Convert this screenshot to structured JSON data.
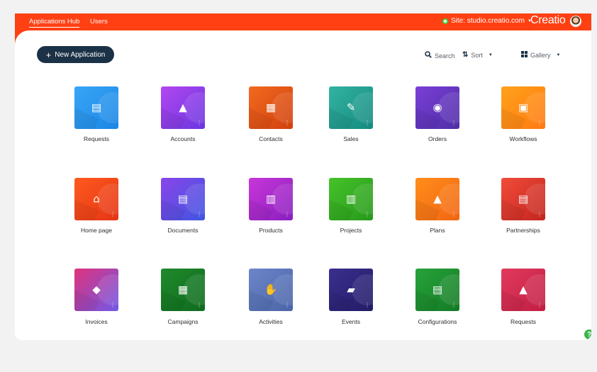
{
  "header": {
    "tabs": [
      "Applications Hub",
      "Users"
    ],
    "site_label": "Site: studio.creatio.com",
    "brand": "Creatio"
  },
  "toolbar": {
    "new_button": "New Application",
    "search_label": "Search",
    "sort_label": "Sort",
    "view_label": "Gallery"
  },
  "apps": [
    {
      "label": "Requests",
      "color_top": "#39a6f7",
      "color_bottom": "#1b86e4",
      "icon": "document-sign-icon",
      "glyph": "▤"
    },
    {
      "label": "Accounts",
      "color_top": "#b347f0",
      "color_bottom": "#6a36e0",
      "icon": "person-card-icon",
      "glyph": "▲"
    },
    {
      "label": "Contacts",
      "color_top": "#f26a1f",
      "color_bottom": "#d1400e",
      "icon": "id-card-add-icon",
      "glyph": "▦"
    },
    {
      "label": "Sales",
      "color_top": "#33b3a1",
      "color_bottom": "#148a80",
      "icon": "pencil-document-icon",
      "glyph": "✎"
    },
    {
      "label": "Orders",
      "color_top": "#7a3fd6",
      "color_bottom": "#4f2ea7",
      "icon": "coins-info-icon",
      "glyph": "◉"
    },
    {
      "label": "Workflows",
      "color_top": "#ffa21a",
      "color_bottom": "#ff7a12",
      "icon": "photo-stack-icon",
      "glyph": "▣"
    },
    {
      "label": "Home page",
      "color_top": "#ff5a1f",
      "color_bottom": "#e43414",
      "icon": "home-icon",
      "glyph": "⌂"
    },
    {
      "label": "Documents",
      "color_top": "#8a45ea",
      "color_bottom": "#3f55e0",
      "icon": "document-info-icon",
      "glyph": "▤"
    },
    {
      "label": "Products",
      "color_top": "#c936d9",
      "color_bottom": "#8a1fbf",
      "icon": "buildings-icon",
      "glyph": "▥"
    },
    {
      "label": "Projects",
      "color_top": "#47c22a",
      "color_bottom": "#25991b",
      "icon": "building-icon",
      "glyph": "▥"
    },
    {
      "label": "Plans",
      "color_top": "#ff8e1a",
      "color_bottom": "#f26512",
      "icon": "person-icon",
      "glyph": "▲"
    },
    {
      "label": "Partnerships",
      "color_top": "#f24c3a",
      "color_bottom": "#c2251f",
      "icon": "document-lock-icon",
      "glyph": "▤"
    },
    {
      "label": "Invoices",
      "color_top": "#e0327a",
      "color_bottom": "#6f58e8",
      "icon": "hand-diamond-icon",
      "glyph": "◆"
    },
    {
      "label": "Campaigns",
      "color_top": "#1f8a2c",
      "color_bottom": "#0f6b1e",
      "icon": "calculator-icon",
      "glyph": "▦"
    },
    {
      "label": "Activities",
      "color_top": "#6c86c9",
      "color_bottom": "#4a64a8",
      "icon": "hand-gears-icon",
      "glyph": "✋"
    },
    {
      "label": "Events",
      "color_top": "#3b2f8f",
      "color_bottom": "#231b66",
      "icon": "chat-bubbles-icon",
      "glyph": "▰"
    },
    {
      "label": "Configurations",
      "color_top": "#27a33b",
      "color_bottom": "#147a25",
      "icon": "document-gear-icon",
      "glyph": "▤"
    },
    {
      "label": "Requests",
      "color_top": "#e23a5d",
      "color_bottom": "#c11e44",
      "icon": "person-list-icon",
      "glyph": "▲"
    }
  ],
  "help_glyph": "?"
}
